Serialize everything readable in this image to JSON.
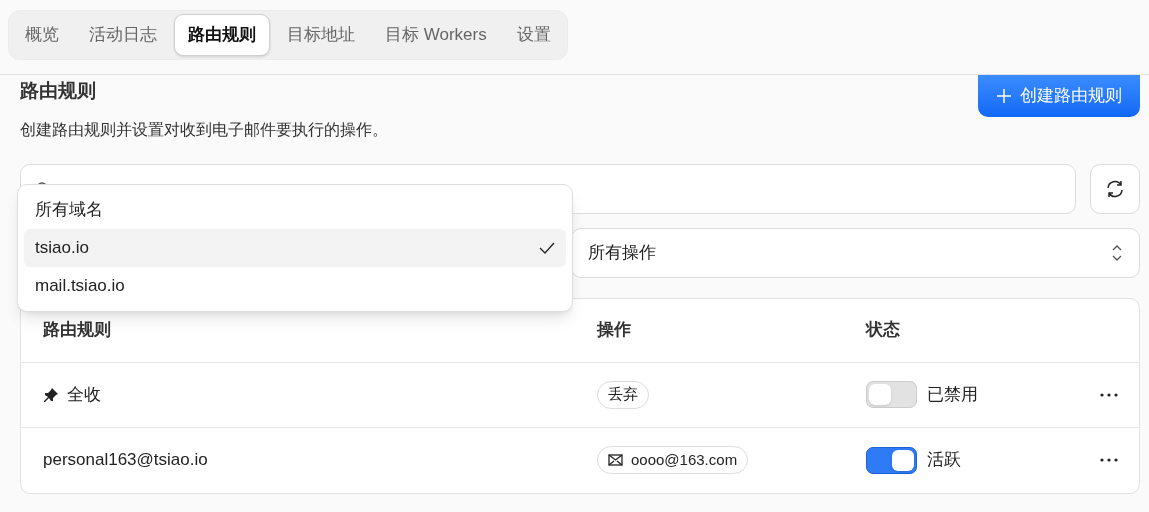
{
  "tabs": [
    {
      "label": "概览",
      "selected": false
    },
    {
      "label": "活动日志",
      "selected": false
    },
    {
      "label": "路由规则",
      "selected": true
    },
    {
      "label": "目标地址",
      "selected": false
    },
    {
      "label": "目标 Workers",
      "selected": false
    },
    {
      "label": "设置",
      "selected": false
    }
  ],
  "header": {
    "title": "路由规则",
    "description": "创建路由规则并设置对收到电子邮件要执行的操作。",
    "create_button": "创建路由规则"
  },
  "action_filter": {
    "value": "所有操作"
  },
  "domain_dropdown": {
    "options": [
      {
        "label": "所有域名",
        "selected": false
      },
      {
        "label": "tsiao.io",
        "selected": true
      },
      {
        "label": "mail.tsiao.io",
        "selected": false
      }
    ]
  },
  "table": {
    "columns": [
      "路由规则",
      "操作",
      "状态"
    ],
    "rows": [
      {
        "rule": "全收",
        "pinned": true,
        "action": {
          "kind": "plain",
          "label": "丢弃"
        },
        "on": false,
        "status": "已禁用"
      },
      {
        "rule": "personal163@tsiao.io",
        "pinned": false,
        "action": {
          "kind": "email",
          "label": "oooo@163.com"
        },
        "on": true,
        "status": "活跃"
      }
    ]
  }
}
